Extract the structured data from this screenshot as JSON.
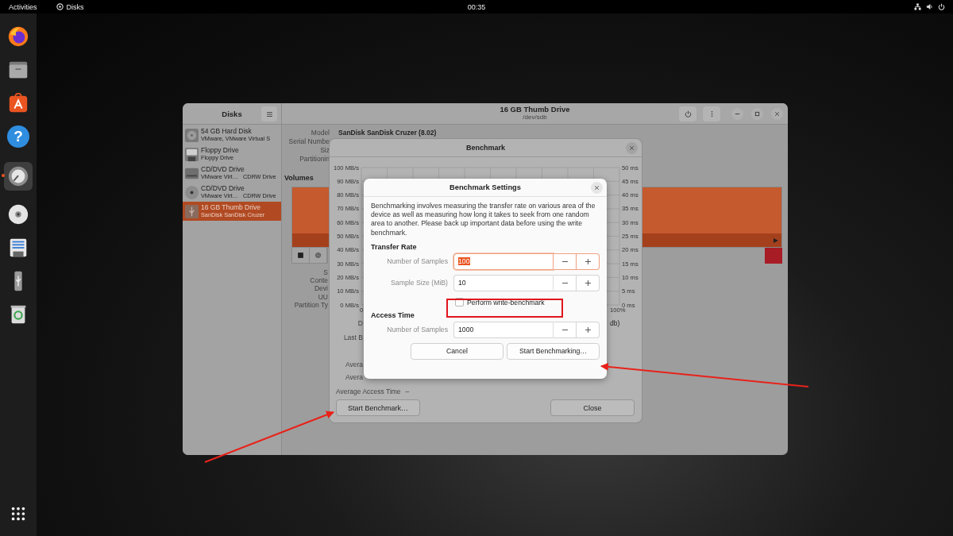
{
  "top_bar": {
    "activities": "Activities",
    "app": "Disks",
    "clock": "00:35"
  },
  "dock": [
    {
      "kind": "firefox",
      "running": false
    },
    {
      "kind": "files",
      "running": false
    },
    {
      "kind": "software",
      "running": false
    },
    {
      "kind": "help",
      "glyph": "?",
      "running": false
    },
    {
      "kind": "disks",
      "running": true
    },
    {
      "kind": "disc",
      "running": false
    },
    {
      "kind": "floppy",
      "running": false
    },
    {
      "kind": "usb",
      "running": false
    },
    {
      "kind": "trash",
      "running": false
    },
    {
      "kind": "apps",
      "running": false
    }
  ],
  "disks_window": {
    "sidebar_title": "Disks",
    "title": "16 GB Thumb Drive",
    "subtitle": "/dev/sdb",
    "drives": [
      {
        "kind": "hdd",
        "name": "54 GB Hard Disk",
        "detail": "VMware, VMware Virtual S",
        "selected": false
      },
      {
        "kind": "floppy",
        "name": "Floppy Drive",
        "detail": "Floppy Drive",
        "selected": false
      },
      {
        "kind": "optical-drive",
        "name": "CD/DVD Drive",
        "detail": "VMware Virt…",
        "media": "CDRW Drive",
        "selected": false
      },
      {
        "kind": "disc",
        "name": "CD/DVD Drive",
        "detail": "VMware Virt…",
        "media": "CDRW Drive",
        "selected": false
      },
      {
        "kind": "usb",
        "name": "16 GB Thumb Drive",
        "detail": "SanDisk SanDisk Cruzer",
        "selected": true
      }
    ],
    "info": [
      {
        "label": "Model",
        "value": "SanDisk SanDisk Cruzer (8.02)"
      },
      {
        "label": "Serial Numbe"
      },
      {
        "label": "Siz"
      },
      {
        "label": "Partitionin"
      }
    ],
    "volumes_heading": "Volumes",
    "volume_info": [
      "S",
      "Conte",
      "Devi",
      "UU",
      "Partition Ty"
    ]
  },
  "benchmark_dialog": {
    "title": "Benchmark",
    "rate_ticks": [
      "100 MB/s",
      "90 MB/s",
      "80 MB/s",
      "70 MB/s",
      "60 MB/s",
      "50 MB/s",
      "40 MB/s",
      "30 MB/s",
      "20 MB/s",
      "10 MB/s",
      "0 MB/s"
    ],
    "time_ticks": [
      "50 ms",
      "45 ms",
      "40 ms",
      "35 ms",
      "30 ms",
      "25 ms",
      "20 ms",
      "15 ms",
      "10 ms",
      "5 ms",
      "0 ms"
    ],
    "x_start": "0",
    "x_end": "100%",
    "rows": [
      "D",
      "Last B"
    ],
    "side_text": "db)",
    "averages": [
      "Avera",
      "Avera"
    ],
    "access_label": "Average Access Time",
    "access_value": "–",
    "start_button": "Start Benchmark…",
    "close_button": "Close"
  },
  "settings_dialog": {
    "title": "Benchmark Settings",
    "description": "Benchmarking involves measuring the transfer rate on various area of the device as well as measuring how long it takes to seek from one random area to another. Please back up important data before using the write benchmark.",
    "transfer_heading": "Transfer Rate",
    "transfer_fields": [
      {
        "label": "Number of Samples",
        "value": "100",
        "focused": true
      },
      {
        "label": "Sample Size (MiB)",
        "value": "10",
        "focused": false
      }
    ],
    "write_benchmark": {
      "label": "Perform write-benchmark",
      "checked": false
    },
    "access_heading": "Access Time",
    "access_fields": [
      {
        "label": "Number of Samples",
        "value": "1000",
        "focused": false
      }
    ],
    "cancel_button": "Cancel",
    "start_button": "Start Benchmarking…"
  }
}
